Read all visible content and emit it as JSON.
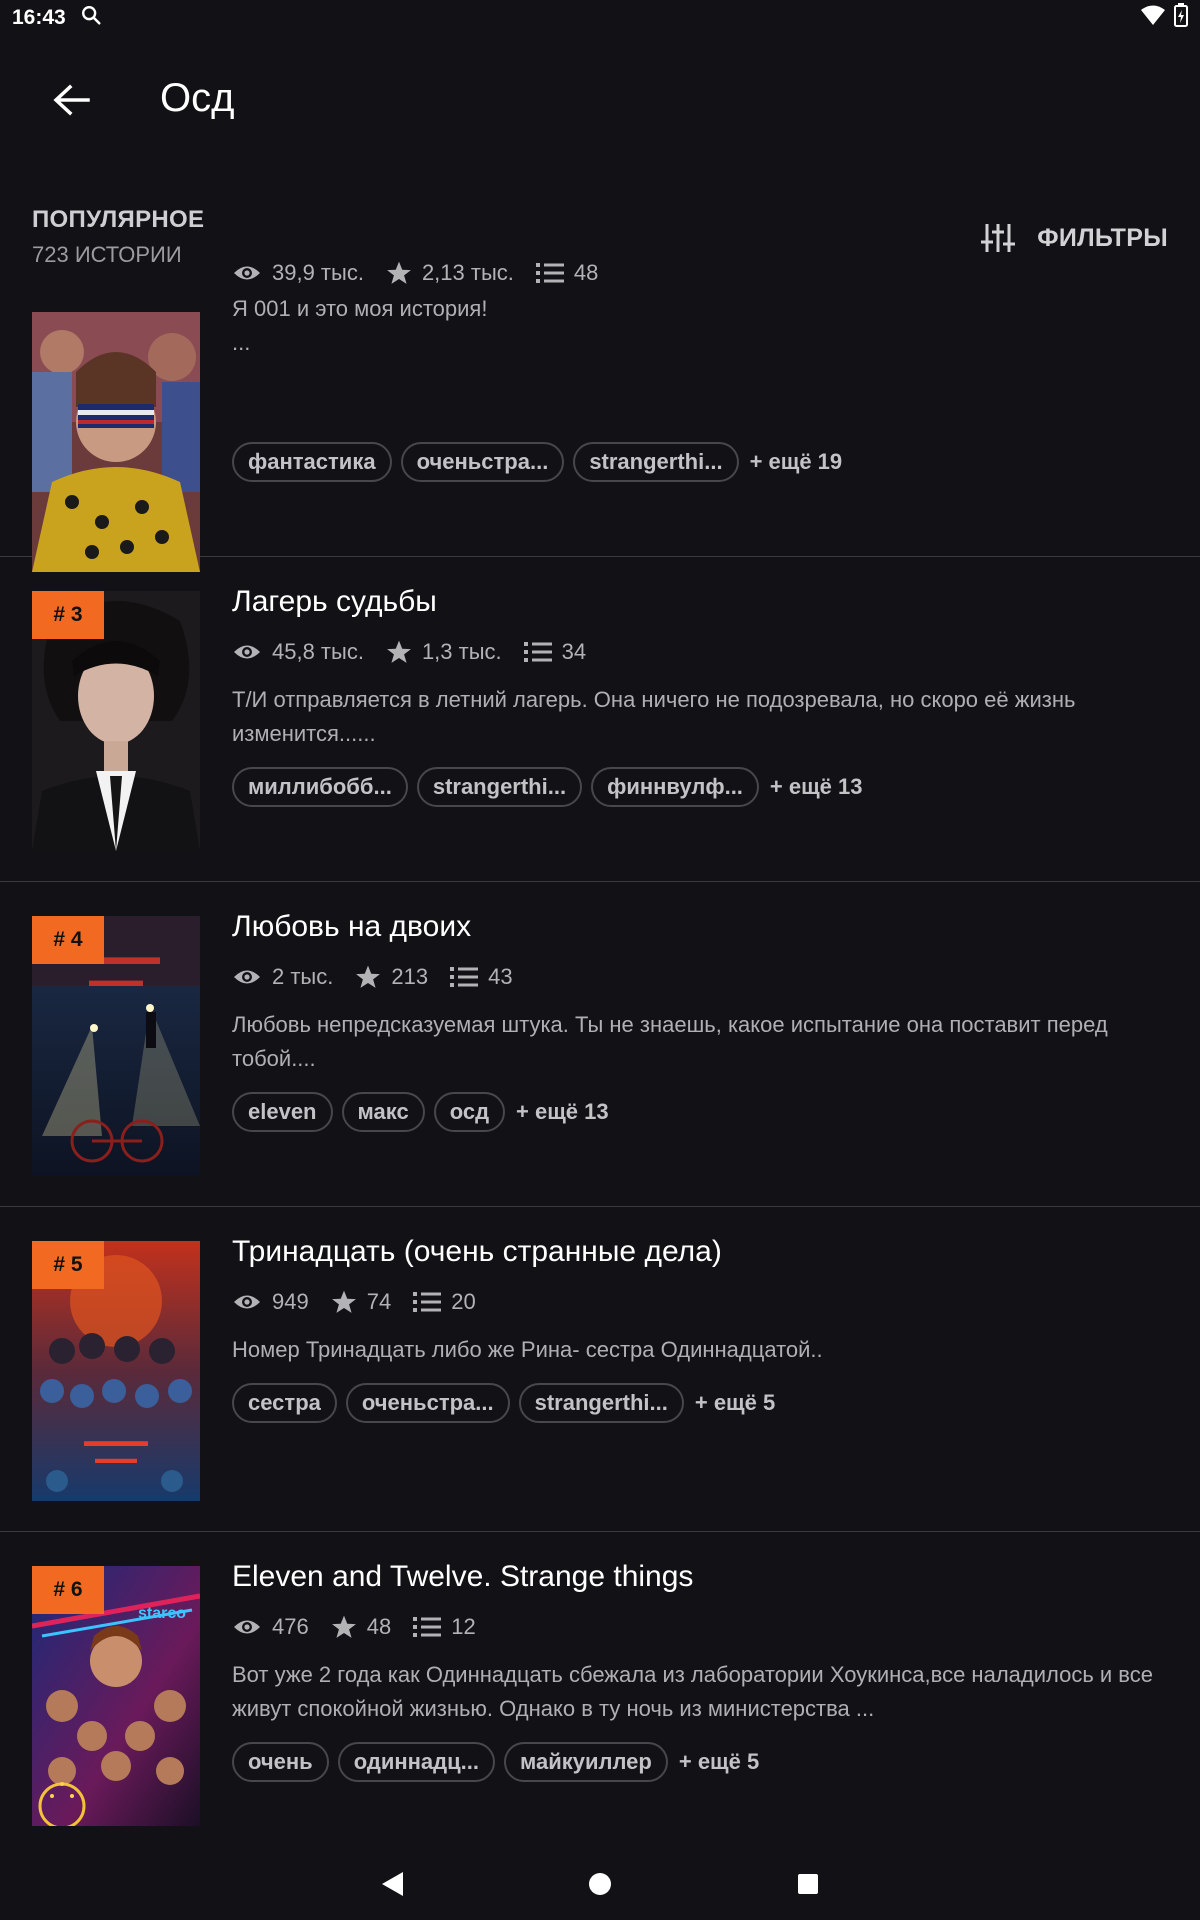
{
  "status_bar": {
    "time": "16:43"
  },
  "header": {
    "title": "Осд"
  },
  "section": {
    "title": "ПОПУЛЯРНОЕ",
    "count": "723 ИСТОРИИ",
    "filters_label": "ФИЛЬТРЫ"
  },
  "stories": [
    {
      "rank": "",
      "title": "",
      "views": "39,9 тыс.",
      "votes": "2,13 тыс.",
      "parts": "48",
      "desc": "Я 001 и это моя история!\n...",
      "tags": [
        "фантастика",
        "оченьстра...",
        "strangerthi..."
      ],
      "more": "+ ещё 19"
    },
    {
      "rank": "# 3",
      "title": "Лагерь судьбы",
      "views": "45,8 тыс.",
      "votes": "1,3 тыс.",
      "parts": "34",
      "desc": "Т/И отправляется в летний лагерь. Она ничего не подозревала, но скоро её жизнь изменится......",
      "tags": [
        "миллибобб...",
        "strangerthi...",
        "финнвулф..."
      ],
      "more": "+ ещё 13"
    },
    {
      "rank": "# 4",
      "title": "Любовь на двоих",
      "views": "2 тыс.",
      "votes": "213",
      "parts": "43",
      "desc": "Любовь непредсказуемая штука. Ты не знаешь, какое испытание она поставит перед тобой....",
      "tags": [
        "eleven",
        "макс",
        "осд"
      ],
      "more": "+ ещё 13"
    },
    {
      "rank": "# 5",
      "title": "Тринадцать (очень странные дела)",
      "views": "949",
      "votes": "74",
      "parts": "20",
      "desc": "Номер Тринадцать либо же Рина- сестра Одиннадцатой..",
      "tags": [
        "сестра",
        "оченьстра...",
        "strangerthi..."
      ],
      "more": "+ ещё 5"
    },
    {
      "rank": "# 6",
      "title": "Eleven and Twelve. Strange things",
      "views": "476",
      "votes": "48",
      "parts": "12",
      "desc": "Вот уже 2 года как Одиннадцать сбежала из лаборатории Хоукинса,все наладилось и все живут спокойной жизнью. Однако в ту ночь из министерства ...",
      "tags": [
        "очень",
        "одиннадц...",
        "майкуиллер"
      ],
      "more": "+ ещё 5"
    }
  ],
  "covers": {
    "cover_1": "Stranger Things character with blindfold poster",
    "cover_2": "Portrait of boy in suit",
    "cover_3": "Stranger Things season 1 poster",
    "cover_4": "Stranger Things season 2 poster",
    "cover_5": "Stranger Things season 3 poster"
  }
}
